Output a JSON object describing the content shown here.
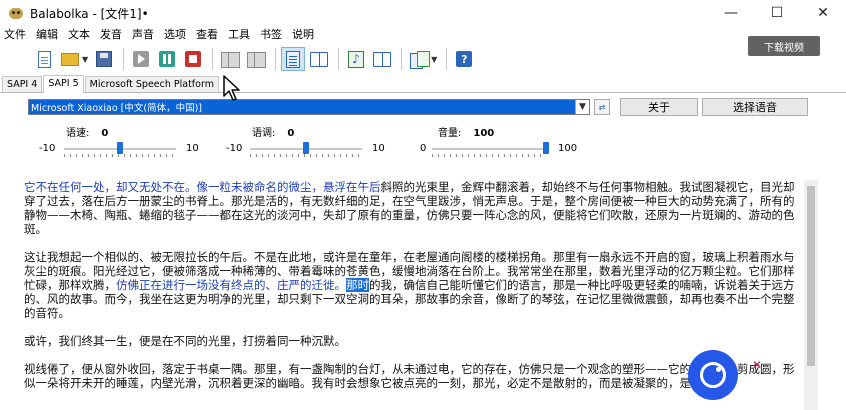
{
  "window": {
    "title": "Balabolka - [文件1]•",
    "controls": [
      "—",
      "☐",
      "✕"
    ]
  },
  "menu": [
    "文件",
    "编辑",
    "文本",
    "发音",
    "声音",
    "选项",
    "查看",
    "工具",
    "书签",
    "说明"
  ],
  "overlay": {
    "download_video": "下载视频"
  },
  "tabs": [
    "SAPI 4",
    "SAPI 5",
    "Microsoft Speech Platform"
  ],
  "active_tab": "SAPI 5",
  "voice": {
    "selected": "Microsoft Xiaoxiao [中文(简体，中国)]",
    "about_button": "关于",
    "select_voice_button": "选择语音"
  },
  "sliders": [
    {
      "label": "语速:",
      "value": "0",
      "min": "-10",
      "max": "10",
      "level": 0.5
    },
    {
      "label": "语调:",
      "value": "0",
      "min": "-10",
      "max": "10",
      "level": 0.5
    },
    {
      "label": "音量:",
      "value": "100",
      "min": "0",
      "max": "100",
      "level": 1.0
    }
  ],
  "editor": {
    "p1_blue": "它不在任何一处，却又无处不在。像一粒未被命名的微尘，悬浮在午后",
    "p1_rest": "斜照的光束里，金辉中翻滚着，却始终不与任何事物相触。我试图凝视它，目光却穿了过去，落在后方一册蒙尘的书脊上。那光是活的，有无数纤细的足，在空气里跋涉，悄无声息。于是，整个房间便被一种巨大的动势充满了，所有的静物——木椅、陶瓶、蜷缩的毯子——都在这光的淡河中，失却了原有的重量，仿佛只要一阵心念的风，便能将它们吹散，还原为一片斑斓的、游动的色斑。",
    "p2_a": "这让我想起一个相似的、被无限拉长的午后。不是在此地，或许是在童年，在老屋通向阁楼的楼梯拐角。那里有一扇永远不开启的窗，玻璃上积着雨水与灰尘的斑痕。阳光经过它，便被筛落成一种稀薄的、带着霉味的苍黄色，缓慢地淌落在台阶上。我常常坐在那里，数着光里浮动的亿万颗尘粒。它们那样忙碌，那样欢腾，",
    "p2_blue": "仿佛正在进行一场没有终点的、庄严的迁徙。",
    "p2_sel": "那时",
    "p2_b": "的我，确信自己能听懂它们的语言，那是一种比呼吸更轻柔的喃喃，诉说着关于远方的、风的故事。而今，我坐在这更为明净的光里，却只剩下一双空洞的耳朵，那故事的余音，像断了的琴弦，在记忆里微微震颤，却再也奏不出一个完整的音符。",
    "p3": "或许，我们终其一生，便是在不同的光里，打捞着同一种沉默。",
    "p4": "视线倦了，便从窗外收回，落定于书桌一隅。那里，有一盏陶制的台灯，从未通过电，它的存在，仿佛只是一个观念的塑形——它的灯罩被裁剪成圆，形似一朵将开未开的睡莲，内壁光滑，沉积着更深的幽暗。我有时会想象它被点亮的一刻，那光，必定不是散射的，而是被凝聚的，是温热的。"
  }
}
